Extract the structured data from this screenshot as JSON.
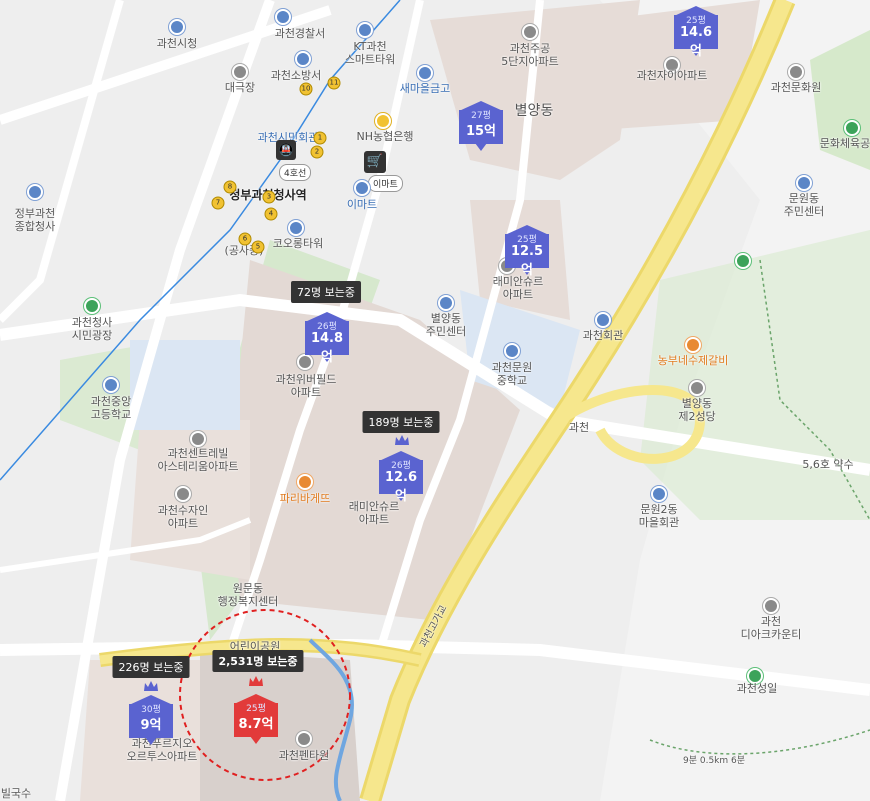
{
  "map": {
    "district_labels": {
      "byeolyang_dong": "별양동"
    },
    "places": {
      "gwacheon_city_hall": "과천시청",
      "gwacheon_police": "과천경찰서",
      "kt_gwacheon": "KT과천\n스마트타워",
      "jugong5": "과천주공\n5단지아파트",
      "xi_apt": "과천자이아파트",
      "culture_center": "과천문화원",
      "sports_park": "문화체육공",
      "daegukjang": "대극장",
      "fire_station": "과천소방서",
      "saemaeul": "새마을금고",
      "nh_bank": "NH농협은행",
      "city_hall_station": "과천시민회관",
      "line4": "4호선",
      "emart_chip": "이마트",
      "emart": "이마트",
      "gov_station": "정부과천청사역",
      "gov_complex": "정부과천\n종합청사",
      "gongsa": "(공사중)",
      "kolon_tower": "코오롱타워",
      "munwon_center": "문원동\n주민센터",
      "gov_plaza": "과천청사\n시민광장",
      "central_high": "과천중앙\n고등학교",
      "wiverfield": "과천위버필드\n아파트",
      "byeolyang_center": "별양동\n주민센터",
      "raemian_apt": "래미안슈르\n아파트",
      "munwon_middle": "과천문원\n중학교",
      "gwacheon_hall": "과천회관",
      "nongbu": "농부네수제갈비",
      "byeolyang_church": "별양동\n제2성당",
      "ic_gwacheon": "과천",
      "mineral_spring": "5,6호 약수",
      "centrale_apt": "과천센트레빌\n아스테리움아파트",
      "paris_baguette": "파리바게뜨",
      "raemian_apt2": "래미안슈르\n아파트",
      "sujain": "과천수자인\n아파트",
      "munwon2_hall": "문원2동\n마을회관",
      "wonmun_center": "원문동\n행정복지센터",
      "eodeuri_park": "어린이공원",
      "gwacheon_overpass": "과천고가교",
      "dk_country": "과천\n디아크카운티",
      "gwacheon_sungil": "과천성일",
      "prugio": "과천푸르지오\n오르투스아파트",
      "gwacheon_tower": "과천펜타원",
      "trail": "9분 0.5km 6분",
      "bottom_left": "빌국수",
      "line4_road": "4호선"
    },
    "listings": [
      {
        "size": "25평",
        "price": "14.6억",
        "color": "#5a63d0"
      },
      {
        "size": "27평",
        "price": "15억",
        "color": "#5a63d0"
      },
      {
        "size": "25평",
        "price": "12.5억",
        "color": "#5a63d0"
      },
      {
        "size": "26평",
        "price": "14.8억",
        "color": "#5a63d0",
        "viewers": "72명 보는중"
      },
      {
        "size": "26평",
        "price": "12.6억",
        "color": "#5a63d0",
        "viewers": "189명 보는중"
      },
      {
        "size": "30평",
        "price": "9억",
        "color": "#5a63d0",
        "viewers": "226명 보는중"
      },
      {
        "size": "25평",
        "price": "8.7억",
        "color": "#e23a3a",
        "viewers": "2,531명 보는중"
      }
    ],
    "subway_exits": [
      "1",
      "2",
      "3",
      "4",
      "5",
      "6",
      "7",
      "8",
      "10",
      "11"
    ],
    "highlight_color": "#e02020"
  }
}
